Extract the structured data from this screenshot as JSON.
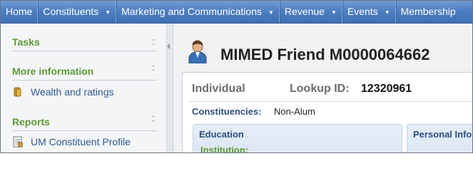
{
  "nav": {
    "items": [
      {
        "label": "Home",
        "has_menu": false
      },
      {
        "label": "Constituents",
        "has_menu": true
      },
      {
        "label": "Marketing and Communications",
        "has_menu": true
      },
      {
        "label": "Revenue",
        "has_menu": true
      },
      {
        "label": "Events",
        "has_menu": true
      },
      {
        "label": "Membership",
        "has_menu": false
      }
    ]
  },
  "sidebar": {
    "tasks_title": "Tasks",
    "more_info_title": "More information",
    "wealth_link": "Wealth and ratings",
    "reports_title": "Reports",
    "report_link": "UM Constituent Profile"
  },
  "record": {
    "title": "MIMED Friend M0000064662",
    "type": "Individual",
    "lookup_label": "Lookup ID:",
    "lookup_value": "12320961",
    "constituencies_label": "Constituencies:",
    "constituencies_value": "Non-Alum"
  },
  "education": {
    "title": "Education",
    "institution_label": "Institution:"
  },
  "personal_info": {
    "title": "Personal Info"
  },
  "colors": {
    "nav_blue": "#4e7fc2",
    "sidebar_section_green": "#5d9a35",
    "link_blue": "#2f5a90"
  }
}
